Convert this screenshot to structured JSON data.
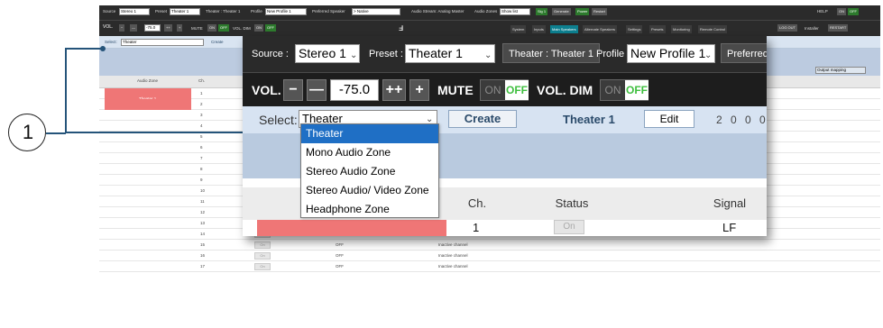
{
  "callout": {
    "number": "1"
  },
  "colors": {
    "callout_line": "#25547a",
    "zone_red": "#ef7676",
    "selected_item": "#1f6fc5",
    "off_green": "#3fbf3f",
    "active_tab": "#0d7f8f"
  },
  "top_bar": {
    "source_label": "Source :",
    "source_value": "Stereo 1",
    "preset_label": "Preset :",
    "preset_value": "Theater 1",
    "theater_label": "Theater : Theater 1",
    "profile_label": "Profile :",
    "profile_value": "New Profile 1",
    "preferred_label": "Preferred U"
  },
  "mini_header": {
    "source": "Source",
    "source_value": "Stereo 1",
    "preset": "Preset",
    "preset_value": "Theater 1",
    "theater": "Theater : Theater 1",
    "profile": "Profile",
    "profile_value": "New Profile 1",
    "preferred": "Preferred Speaker",
    "preferred_value": "> Native",
    "audio_stream": "Audio Stream: Analog Master",
    "audio_zones": "Audio Zones",
    "audio_zones_value": "Show list",
    "btn_sig": "Sig 1",
    "btn_generate": "Generate",
    "btn_power": "Power",
    "btn_restart": "Restart",
    "help": "HELP",
    "help_on": "ON",
    "help_off": "OFF"
  },
  "mini_tabs": [
    "System",
    "Inputs",
    "Main Speakers",
    "Alternate Speakers",
    "Settings",
    "Presets",
    "Monitoring",
    "Remote Control"
  ],
  "mini_right_buttons": [
    "LOG OUT",
    "Installer",
    "RESTART"
  ],
  "mini_select": {
    "label": "Select:",
    "value": "Theater",
    "create": "Create",
    "output_mapping": "Output mapping"
  },
  "mini_table": {
    "col_audio_zone": "Audio Zone",
    "col_ch": "Ch.",
    "zone_name": "Theater 1",
    "channels": [
      "1",
      "2",
      "3",
      "4",
      "5",
      "6",
      "7",
      "8",
      "9",
      "10",
      "11",
      "12",
      "13",
      "14",
      "15",
      "16",
      "17"
    ],
    "off_text": "OFF",
    "inactive_text": "Inactive channel",
    "on_text": "On"
  },
  "volume": {
    "label": "VOL.",
    "minus": "−",
    "double_minus": "—",
    "value": "-75.0",
    "double_plus": "++",
    "plus": "+",
    "mute_label": "MUTE",
    "mute_on": "ON",
    "mute_off": "OFF",
    "voldim_label": "VOL. DIM",
    "voldim_on": "ON",
    "voldim_off": "OFF"
  },
  "zone_select": {
    "label": "Select:",
    "value": "Theater",
    "create": "Create",
    "zone_name": "Theater 1",
    "edit": "Edit",
    "nums": "2 0 0 0"
  },
  "dropdown": {
    "options": [
      "Theater",
      "Mono Audio Zone",
      "Stereo Audio Zone",
      "Stereo Audio/ Video Zone",
      "Headphone Zone"
    ],
    "selected_index": 0
  },
  "zoom_table": {
    "col_ch": "Ch.",
    "col_status": "Status",
    "col_signal": "Signal",
    "row_ch": "1",
    "row_status": "On",
    "row_signal": "LF"
  }
}
